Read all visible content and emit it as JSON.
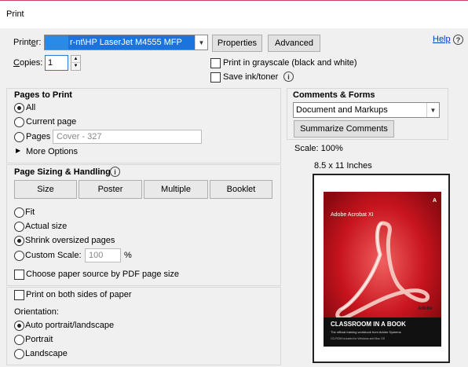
{
  "window": {
    "title": "Print"
  },
  "printer": {
    "label": "Printer:",
    "selected": "r-nt\\HP LaserJet M4555 MFP",
    "properties_label": "Properties",
    "advanced_label": "Advanced",
    "help_label": "Help",
    "help_icon": "?"
  },
  "copies": {
    "label": "Copies:",
    "value": "1"
  },
  "options": {
    "grayscale_label": "Print in grayscale (black and white)",
    "save_ink_label": "Save ink/toner"
  },
  "pages_to_print": {
    "title": "Pages to Print",
    "all_label": "All",
    "current_label": "Current page",
    "pages_label": "Pages",
    "pages_value": "Cover - 327",
    "more_options_label": "More Options"
  },
  "sizing": {
    "title": "Page Sizing & Handling",
    "tabs": {
      "size": "Size",
      "poster": "Poster",
      "multiple": "Multiple",
      "booklet": "Booklet"
    },
    "fit_label": "Fit",
    "actual_label": "Actual size",
    "shrink_label": "Shrink oversized pages",
    "custom_label": "Custom Scale:",
    "custom_value": "100",
    "percent": "%",
    "paper_source_label": "Choose paper source by PDF page size"
  },
  "both_sides": {
    "label": "Print on both sides of paper"
  },
  "orientation": {
    "title": "Orientation:",
    "auto_label": "Auto portrait/landscape",
    "portrait_label": "Portrait",
    "landscape_label": "Landscape"
  },
  "comments": {
    "title": "Comments & Forms",
    "selected": "Document and Markups",
    "summarize_label": "Summarize Comments"
  },
  "preview": {
    "scale": "Scale: 100%",
    "paper_size": "8.5 x 11 Inches",
    "book": {
      "brand": "Adobe Acrobat XI",
      "publisher": "Adobe",
      "headline": "CLASSROOM IN A BOOK",
      "subtitle": "The official training workbook from Adobe Systems",
      "small": "CD-ROM included for Windows and Mac OS"
    }
  },
  "colors": {
    "accent": "#d04060",
    "book_red": "#c8141e",
    "link": "#0040c0"
  }
}
